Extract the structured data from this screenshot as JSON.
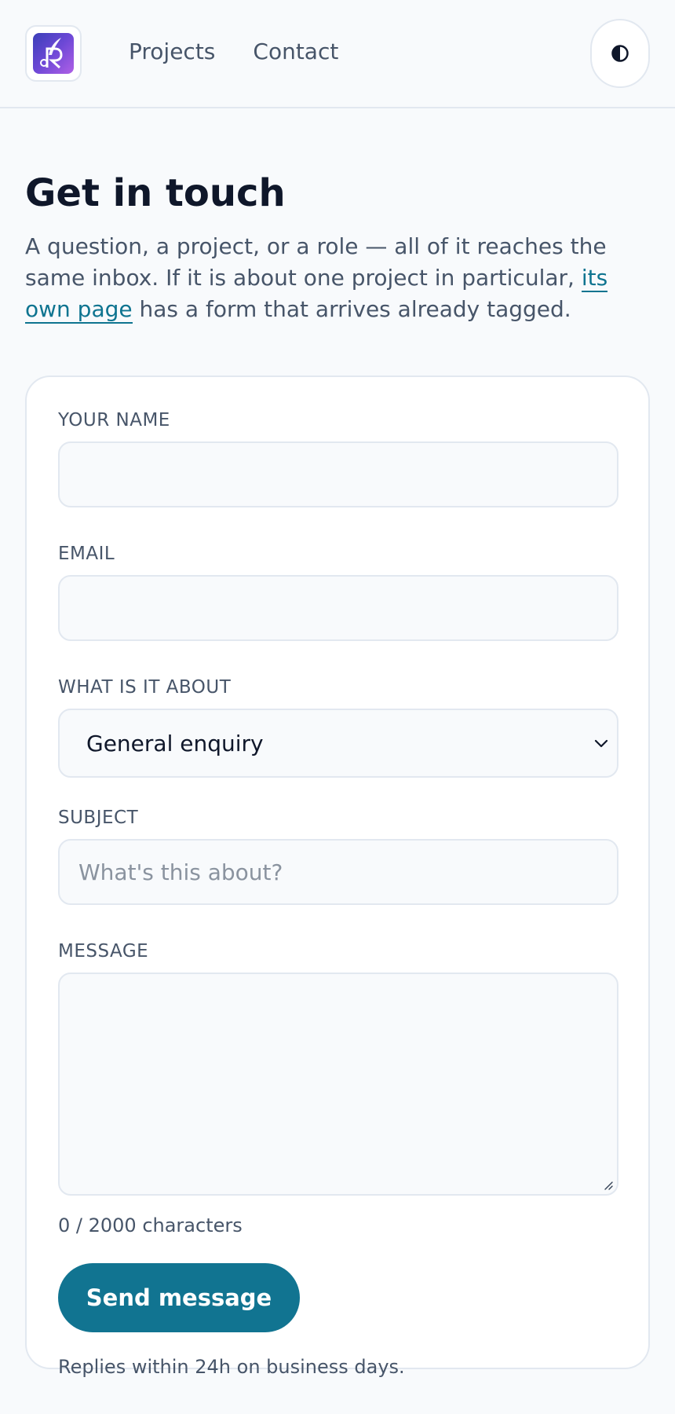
{
  "header": {
    "logo_alt": "logo",
    "nav": [
      {
        "label": "Projects"
      },
      {
        "label": "Contact"
      }
    ],
    "theme_toggle_icon": "contrast-icon"
  },
  "main": {
    "title": "Get in touch",
    "intro_before_link": "A question, a project, or a role — all of it reaches the same inbox. If it is about one project in particular, ",
    "intro_link": "its own page",
    "intro_after_link": " has a form that arrives already tagged."
  },
  "form": {
    "name_label": "YOUR NAME",
    "name_value": "",
    "email_label": "EMAIL",
    "email_value": "",
    "topic_label": "WHAT IS IT ABOUT",
    "topic_selected": "General enquiry",
    "subject_label": "SUBJECT",
    "subject_placeholder": "What's this about?",
    "subject_value": "",
    "message_label": "MESSAGE",
    "message_value": "",
    "char_count": "0 / 2000 characters",
    "send_label": "Send message",
    "reply_note": "Replies within 24h on business days."
  },
  "colors": {
    "accent": "#117491",
    "link": "#0e7490",
    "background": "#f8fafc"
  }
}
